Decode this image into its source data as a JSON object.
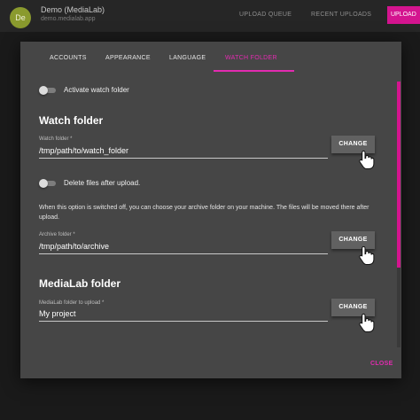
{
  "app": {
    "avatar_initials": "De",
    "title": "Demo (MediaLab)",
    "subtitle": "demo.medialab.app",
    "nav": [
      "UPLOAD QUEUE",
      "RECENT UPLOADS"
    ],
    "upload_label": "UPLOAD"
  },
  "tabs": [
    {
      "label": "ACCOUNTS"
    },
    {
      "label": "APPEARANCE"
    },
    {
      "label": "LANGUAGE"
    },
    {
      "label": "WATCH FOLDER",
      "active": true
    }
  ],
  "settings": {
    "activate_toggle_label": "Activate watch folder",
    "watch_section_title": "Watch folder",
    "watch_field": {
      "label": "Watch folder *",
      "value": "/tmp/path/to/watch_folder"
    },
    "delete_toggle_label": "Delete files after upload.",
    "info_text": "When this option is switched off, you can choose your archive folder on your machine. The files will be moved there after upload.",
    "archive_field": {
      "label": "Archive folder *",
      "value": "/tmp/path/to/archive"
    },
    "medialab_section_title": "MediaLab folder",
    "medialab_field": {
      "label": "MediaLab folder to upload *",
      "value": "My project"
    },
    "change_label": "CHANGE",
    "close_label": "CLOSE"
  },
  "colors": {
    "accent": "#e22bb0",
    "modal_bg": "#464646",
    "button_bg": "#616161"
  },
  "icons": [
    "hand-pointer-icon"
  ]
}
